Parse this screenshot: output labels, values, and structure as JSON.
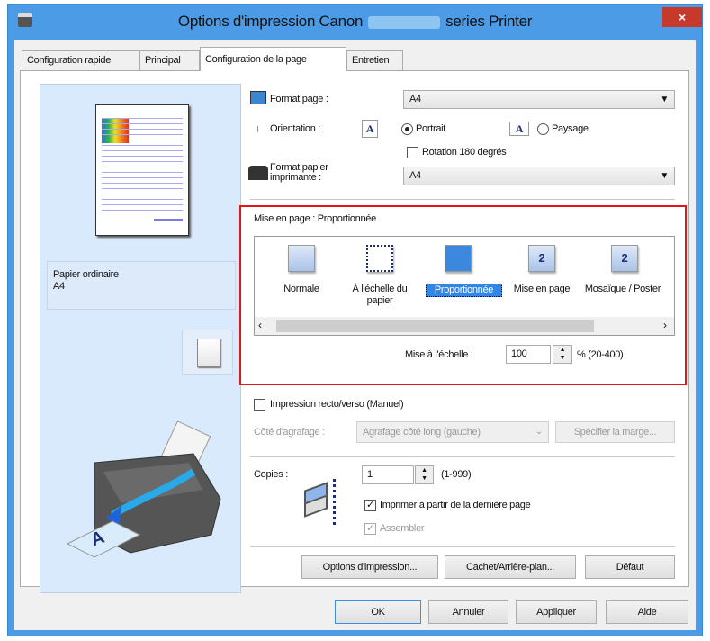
{
  "window": {
    "title_prefix": "Options d'impression Canon",
    "title_suffix": "series Printer",
    "close": "×"
  },
  "tabs": [
    {
      "label": "Configuration rapide"
    },
    {
      "label": "Principal"
    },
    {
      "label": "Configuration de la page",
      "active": true
    },
    {
      "label": "Entretien"
    }
  ],
  "preview": {
    "media": "Papier ordinaire",
    "size": "A4"
  },
  "page_size": {
    "label": "Format page :",
    "value": "A4"
  },
  "orientation": {
    "label": "Orientation :",
    "portrait": "Portrait",
    "landscape": "Paysage",
    "selected": "Portrait",
    "rotate_label": "Rotation 180 degrés",
    "rotate_checked": false
  },
  "printer_paper": {
    "label_line1": "Format papier",
    "label_line2": "imprimante :",
    "value": "A4"
  },
  "layout": {
    "label": "Mise en page :",
    "current": "Proportionnée",
    "items": [
      {
        "label": "Normale",
        "icon": ""
      },
      {
        "label": "À l'échelle du papier",
        "icon": ""
      },
      {
        "label": "Proportionnée",
        "icon": "",
        "selected": true
      },
      {
        "label": "Mise en page",
        "icon": "2"
      },
      {
        "label": "Mosaïque / Poster",
        "icon": "2"
      }
    ],
    "scale_label": "Mise à l'échelle :",
    "scale_value": "100",
    "scale_range": "% (20-400)"
  },
  "duplex": {
    "label": "Impression recto/verso (Manuel)",
    "checked": false,
    "staple_label": "Côté d'agrafage :",
    "staple_value": "Agrafage côté long (gauche)",
    "margin_button": "Spécifier la marge..."
  },
  "copies": {
    "label": "Copies :",
    "value": "1",
    "range": "(1-999)",
    "reverse_label": "Imprimer à partir de la dernière page",
    "reverse_checked": true,
    "collate_label": "Assembler",
    "collate_checked": true
  },
  "buttons": {
    "options": "Options d'impression...",
    "stamp": "Cachet/Arrière-plan...",
    "default": "Défaut",
    "ok": "OK",
    "cancel": "Annuler",
    "apply": "Appliquer",
    "help": "Aide"
  },
  "colors": {
    "title_bar": "#4b9be6",
    "highlight_box": "#e3141a",
    "selection": "#3287e6"
  }
}
